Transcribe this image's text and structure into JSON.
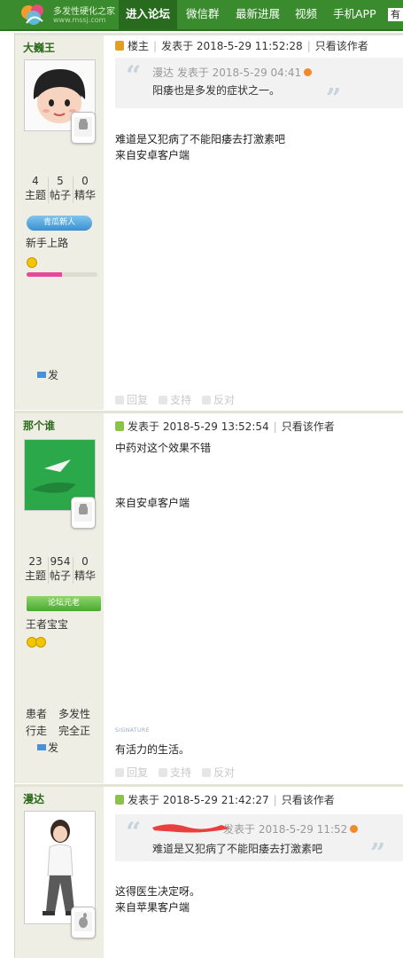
{
  "nav": {
    "logo_title": "多发性硬化之家",
    "logo_url": "www.mssj.com",
    "items": [
      "进入论坛",
      "微信群",
      "最新进展",
      "视频",
      "手机APP"
    ],
    "overflow": "有"
  },
  "posts": [
    {
      "username": "大巍王",
      "stats": {
        "threads": "4",
        "posts": "5",
        "digest": "0"
      },
      "stat_labels": {
        "threads": "主题",
        "posts": "帖子",
        "digest": "精华"
      },
      "group_badge": "青瓜新人",
      "group_name": "新手上路",
      "pm_label": "发",
      "device": "android",
      "floor_label": "楼主",
      "meta": {
        "posted": "发表于 2018-5-29 11:52:28",
        "author_only": "只看该作者"
      },
      "quote": {
        "head": "漫达 发表于 2018-5-29 04:41",
        "text": "阳痿也是多发的症状之一。"
      },
      "lines": [
        "难道是又犯病了不能阳痿去打激素吧",
        "来自安卓客户端"
      ],
      "actions": {
        "reply": "回复",
        "support": "支持",
        "oppose": "反对"
      }
    },
    {
      "username": "那个谁",
      "stats": {
        "threads": "23",
        "posts": "954",
        "digest": "0"
      },
      "stat_labels": {
        "threads": "主题",
        "posts": "帖子",
        "digest": "精华"
      },
      "group_badge": "论坛元老",
      "group_name": "王者宝宝",
      "custom_fields": [
        "患者",
        "多发性",
        "行走",
        "完全正"
      ],
      "pm_label": "发",
      "device": "android",
      "meta": {
        "posted": "发表于 2018-5-29 13:52:54",
        "author_only": "只看该作者"
      },
      "lines": [
        "中药对这个效果不错",
        "来自安卓客户端"
      ],
      "signature_label": "SIGNATURE",
      "signature": "有活力的生活。",
      "actions": {
        "reply": "回复",
        "support": "支持",
        "oppose": "反对"
      }
    },
    {
      "username": "漫达",
      "device": "apple",
      "meta": {
        "posted": "发表于 2018-5-29 21:42:27",
        "author_only": "只看该作者"
      },
      "quote": {
        "head": "发表于 2018-5-29 11:52",
        "text": "难道是又犯病了不能阳痿去打激素吧"
      },
      "lines": [
        "这得医生决定呀。",
        "来自苹果客户端"
      ]
    }
  ],
  "colors": {
    "nav_green": "#3a8a2e",
    "sidebar": "#eeeee4",
    "username": "#2a6a1a",
    "level_bar": "#e8489a"
  },
  "level_progress_post1": 0.5
}
